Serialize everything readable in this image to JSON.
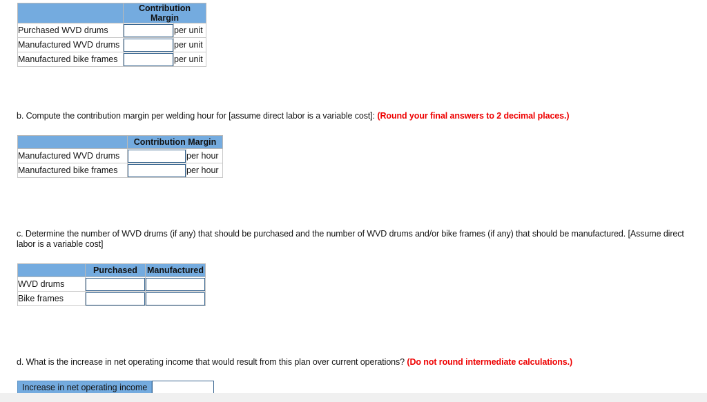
{
  "colors": {
    "header_blue": "#74abdf",
    "input_border": "#36648f",
    "emphasis_red": "#ee0000",
    "table_border": "#b9b9b9",
    "cell_border": "#c8c8c8"
  },
  "table_a": {
    "name": "contribution-margin-per-unit-table",
    "header_blank": "",
    "header_label": "Contribution Margin",
    "rows": [
      {
        "label": "Purchased WVD drums",
        "value": "",
        "unit": "per unit"
      },
      {
        "label": "Manufactured WVD drums",
        "value": "",
        "unit": "per unit"
      },
      {
        "label": "Manufactured bike frames",
        "value": "",
        "unit": "per unit"
      }
    ]
  },
  "question_b": {
    "prefix": "b. Compute the contribution margin per welding hour for [assume direct labor is a variable cost]: ",
    "emphasis": "(Round your final answers to 2 decimal places.)"
  },
  "table_b": {
    "name": "contribution-margin-per-welding-hour-table",
    "header_blank": "",
    "header_label": "Contribution Margin",
    "rows": [
      {
        "label": "Manufactured WVD drums",
        "value": "",
        "unit": "per hour"
      },
      {
        "label": "Manufactured bike frames",
        "value": "",
        "unit": "per hour"
      }
    ]
  },
  "question_c": {
    "line1": "c. Determine the number of WVD drums (if any) that should be purchased and the number of WVD drums and/or bike frames (if any) that should be manufactured. [Assume direct",
    "line2": "labor is a variable cost]"
  },
  "table_c": {
    "name": "purchased-vs-manufactured-quantities-table",
    "header_blank": "",
    "headers": [
      "Purchased",
      "Manufactured"
    ],
    "rows": [
      {
        "label": "WVD drums",
        "purchased": "",
        "manufactured": ""
      },
      {
        "label": "Bike frames",
        "purchased": "",
        "manufactured": ""
      }
    ]
  },
  "question_d": {
    "prefix": "d. What is the increase in net operating income that would result from this plan over current operations? ",
    "emphasis": "(Do not round intermediate calculations.)"
  },
  "answer_d": {
    "name": "increase-in-net-operating-income-row",
    "label": "Increase in net operating income",
    "value": ""
  }
}
